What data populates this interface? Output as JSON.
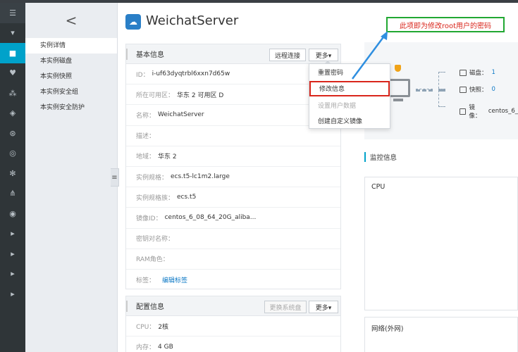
{
  "rail": {
    "icons": [
      "menu-icon",
      "collapse-icon",
      "instance-icon",
      "heart-icon",
      "nodes-icon",
      "storage-icon",
      "target-icon",
      "radar-icon",
      "asterisk-icon",
      "tree-icon",
      "eye-icon",
      "chevron-right-icon",
      "chevron-right-icon",
      "chevron-right-icon",
      "chevron-right-icon"
    ]
  },
  "subnav": {
    "back": "<",
    "items": [
      "实例详情",
      "本实例磁盘",
      "本实例快照",
      "本实例安全组",
      "本实例安全防护"
    ]
  },
  "header": {
    "title": "WeichatServer"
  },
  "basic": {
    "title": "基本信息",
    "remote_btn": "远程连接",
    "more_btn": "更多▾",
    "rows": [
      {
        "label": "ID：",
        "value": "i-uf63dyqtrbl6xxn7d65w"
      },
      {
        "label": "所在可用区：",
        "value": "华东 2 可用区 D"
      },
      {
        "label": "名称：",
        "value": "WeichatServer"
      },
      {
        "label": "描述：",
        "value": ""
      },
      {
        "label": "地域：",
        "value": "华东 2"
      },
      {
        "label": "实例规格：",
        "value": "ecs.t5-lc1m2.large"
      },
      {
        "label": "实例规格族：",
        "value": "ecs.t5"
      },
      {
        "label": "镜像ID：",
        "value": "centos_6_08_64_20G_aliba..."
      },
      {
        "label": "密钥对名称：",
        "value": ""
      },
      {
        "label": "RAM角色：",
        "value": ""
      },
      {
        "label": "标签：",
        "value": "编辑标签"
      }
    ]
  },
  "config": {
    "title": "配置信息",
    "change_disk_btn": "更换系统盘",
    "more_btn": "更多▾",
    "rows": [
      {
        "label": "CPU：",
        "value": "2核"
      },
      {
        "label": "内存：",
        "value": "4 GB"
      }
    ]
  },
  "dropdown": {
    "items": [
      "重置密码",
      "修改信息",
      "设置用户数据",
      "创建自定义镜像"
    ]
  },
  "annotation": {
    "text": "此项即为修改root用户的密码"
  },
  "resources": {
    "disk": {
      "label": "磁盘：",
      "value": "1"
    },
    "snapshot": {
      "label": "快照：",
      "value": "0"
    },
    "image": {
      "label": "镜像：",
      "value": "centos_6_"
    }
  },
  "monitor": {
    "title": "监控信息",
    "cpu": "CPU",
    "network": "网络(外网)"
  },
  "colors": {
    "accent": "#00a2ca",
    "highlight": "#d9261c",
    "callout_border": "#21a832",
    "link": "#0f7ac6"
  }
}
